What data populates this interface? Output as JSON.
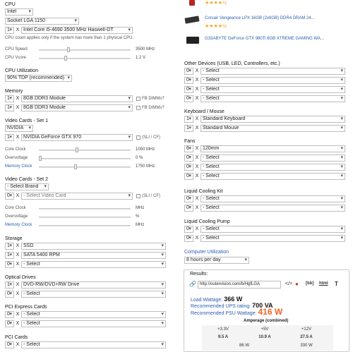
{
  "left": {
    "cpu": {
      "heading": "CPU",
      "brand": "Intel",
      "socket": "Socket LGA 1150",
      "qty": "1",
      "model": "Intel Core i5-4690 3500 MHz Haswell-DT",
      "note": "CPU count applies only if the system has more than 1 physical CPU.",
      "speed_label": "CPU Speed",
      "speed_value": "3500 MHz",
      "vcore_label": "CPU Vcore",
      "vcore_value": "1.2 V"
    },
    "util": {
      "heading": "CPU Utilization",
      "value": "90% TDP (recommended)"
    },
    "memory": {
      "heading": "Memory",
      "rows": [
        {
          "qty": "1",
          "model": "8GB DDR3 Module",
          "cb": "FB DIMMs?"
        },
        {
          "qty": "1",
          "model": "8GB DDR3 Module",
          "cb": "FB DIMMs?"
        }
      ]
    },
    "video1": {
      "heading": "Video Cards - Set 1",
      "brand": "NVIDIA",
      "qty": "1",
      "model": "NVIDIA GeForce GTX 970",
      "cb": "(SLI / CF)",
      "core_label": "Core Clock",
      "core_value": "1050 MHz",
      "ov_label": "Overvoltage",
      "ov_value": "0 %",
      "mem_label": "Memory Clock",
      "mem_value": "1750 MHz"
    },
    "video2": {
      "heading": "Video Cards - Set 2",
      "brand": "- Select Brand",
      "qty": "0",
      "model": "- Select Video Card",
      "cb": "(SLI / CF)",
      "core_label": "Core Clock",
      "core_unit": "MHz",
      "ov_label": "Overvoltage",
      "ov_unit": "%",
      "mem_label": "Memory Clock",
      "mem_unit": "MHz"
    },
    "storage": {
      "heading": "Storage",
      "rows": [
        {
          "qty": "1",
          "model": "SSD"
        },
        {
          "qty": "1",
          "model": "SATA 5400 RPM"
        },
        {
          "qty": "0",
          "model": "- Select"
        }
      ]
    },
    "optical": {
      "heading": "Optical Drives",
      "rows": [
        {
          "qty": "1",
          "model": "DVD-RW/DVD+RW Drive"
        },
        {
          "qty": "0",
          "model": "- Select"
        }
      ]
    },
    "pcie": {
      "heading": "PCI Express Cards",
      "rows": [
        {
          "qty": "0",
          "model": "- Select"
        },
        {
          "qty": "0",
          "model": "- Select"
        }
      ]
    },
    "pci": {
      "heading": "PCI Cards",
      "rows": [
        {
          "qty": "0",
          "model": "- Select"
        }
      ]
    }
  },
  "right": {
    "products": [
      {
        "name": "",
        "stars": "★★★★½"
      },
      {
        "name": "Corsair Vengeance LPX 16GB (2x8GB) DDR4 DRAM 24...",
        "stars": "★★★★½"
      },
      {
        "name": "G33ABYTE GeForce GTX 980Ti 6GB XTREME GAMING WA...",
        "stars": ""
      }
    ],
    "other": {
      "heading": "Other Devices (USB, LED, Controllers, etc.)",
      "rows": [
        {
          "qty": "0",
          "model": "- Select"
        },
        {
          "qty": "0",
          "model": "- Select"
        },
        {
          "qty": "0",
          "model": "- Select"
        },
        {
          "qty": "0",
          "model": "- Select"
        }
      ]
    },
    "kbm": {
      "heading": "Keyboard / Mouse",
      "rows": [
        {
          "qty": "1",
          "model": "Standard Keyboard"
        },
        {
          "qty": "1",
          "model": "Standard Mouse"
        }
      ]
    },
    "fans": {
      "heading": "Fans",
      "rows": [
        {
          "qty": "6",
          "model": "120mm"
        },
        {
          "qty": "0",
          "model": "- Select"
        },
        {
          "qty": "0",
          "model": "- Select"
        },
        {
          "qty": "0",
          "model": "- Select"
        }
      ]
    },
    "lck": {
      "heading": "Liquid Cooling Kit",
      "rows": [
        {
          "qty": "0",
          "model": "- Select"
        },
        {
          "qty": "0",
          "model": "- Select"
        }
      ]
    },
    "lcp": {
      "heading": "Liquid Cooling Pump",
      "rows": [
        {
          "qty": "0",
          "model": "- Select"
        },
        {
          "qty": "0",
          "model": "- Select"
        }
      ]
    },
    "cu": {
      "heading": "Computer Utilization",
      "value": "8 hours per day"
    }
  },
  "results": {
    "title": "Results:",
    "url": "http://outervision.com/b/HgfLGA",
    "load_label": "Load Wattage:",
    "load_value": "366 W",
    "ups_label": "Recommended UPS rating:",
    "ups_value": "700 VA",
    "psu_label": "Recommended PSU Wattage:",
    "psu_value": "416 W",
    "amp_title": "Amperage (combined)",
    "rails": [
      "+3.3V",
      "+5V",
      "+12V"
    ],
    "amps": [
      "9.5 A",
      "10.9 A",
      "27.5 A"
    ],
    "watts": [
      "86 W",
      "",
      "330 W"
    ],
    "icons": {
      "bb": "[bb]",
      "html": "html",
      "t": "T"
    }
  },
  "colors": {
    "accent": "#2a5db0",
    "psu": "#f26522",
    "star": "#f5a623"
  }
}
